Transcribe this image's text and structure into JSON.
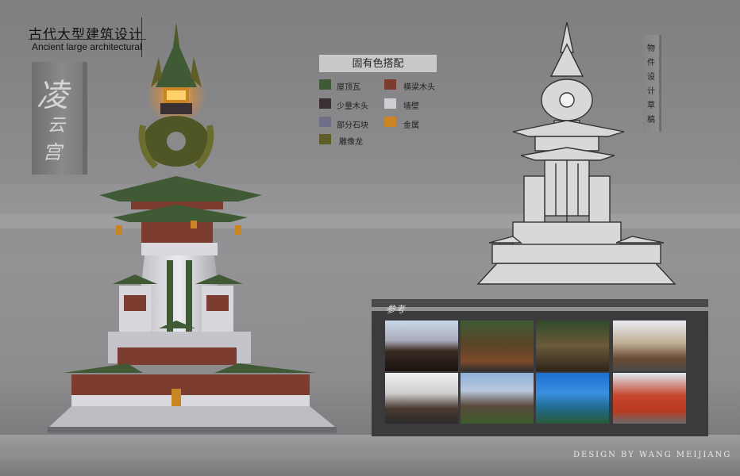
{
  "title": {
    "zh": "古代大型建筑设计",
    "en": "Ancient large architectural"
  },
  "seal": {
    "chars": [
      "凌",
      "云",
      "宫"
    ]
  },
  "palette": {
    "heading": "固有色搭配",
    "items": [
      {
        "label": "屋顶瓦",
        "color": "#3f5a35"
      },
      {
        "label": "横梁木头",
        "color": "#7c3c30"
      },
      {
        "label": "少量木头",
        "color": "#3a2f33"
      },
      {
        "label": "墙壁",
        "color": "#cfcfd3"
      },
      {
        "label": "部分石块",
        "color": "#6f6f88"
      },
      {
        "label": "金属",
        "color": "#c98522"
      },
      {
        "label": "雕像龙",
        "color": "#5e5e26"
      }
    ]
  },
  "sketch_label": [
    "物",
    "件",
    "设",
    "计",
    "草",
    "稿"
  ],
  "reference": {
    "label": "参考"
  },
  "credit": "DESIGN BY WANG MEIJIANG"
}
